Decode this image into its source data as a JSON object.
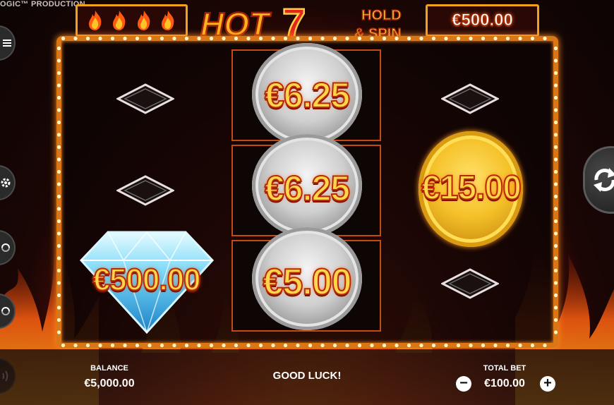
{
  "studio_text": "OGIC™ PRODUCTION",
  "header": {
    "fire_meter": {
      "icon": "flame-icon",
      "count": 4
    },
    "logo": {
      "hot": "HOT",
      "seven": "7",
      "hold": "HOLD",
      "spin": "& SPIN"
    },
    "jackpot": "€500.00"
  },
  "reels": {
    "col1": [
      {
        "symbol": "blank-diamond"
      },
      {
        "symbol": "blank-diamond"
      },
      {
        "symbol": "blue-diamond",
        "prize": "€500.00"
      }
    ],
    "col2": [
      {
        "symbol": "silver-coin",
        "prize": "€6.25"
      },
      {
        "symbol": "silver-coin",
        "prize": "€6.25"
      },
      {
        "symbol": "silver-coin",
        "prize": "€5.00"
      }
    ],
    "col3": [
      {
        "symbol": "blank-diamond"
      },
      {
        "symbol": "gold-coin",
        "prize": "€15.00"
      },
      {
        "symbol": "blank-diamond"
      }
    ]
  },
  "side_buttons": [
    "menu-icon",
    "gear-icon",
    "autoplay-icon",
    "turbo-icon",
    "sound-icon"
  ],
  "spin_button": "spin-icon",
  "bottom": {
    "balance_label": "BALANCE",
    "balance_value": "€5,000.00",
    "message": "GOOD LUCK!",
    "total_bet_label": "TOTAL BET",
    "total_bet_value": "€100.00",
    "minus": "−",
    "plus": "+"
  },
  "colors": {
    "frame": "#d97717",
    "prize_text": "#ffd54a",
    "prize_outline": "#b82a05"
  }
}
